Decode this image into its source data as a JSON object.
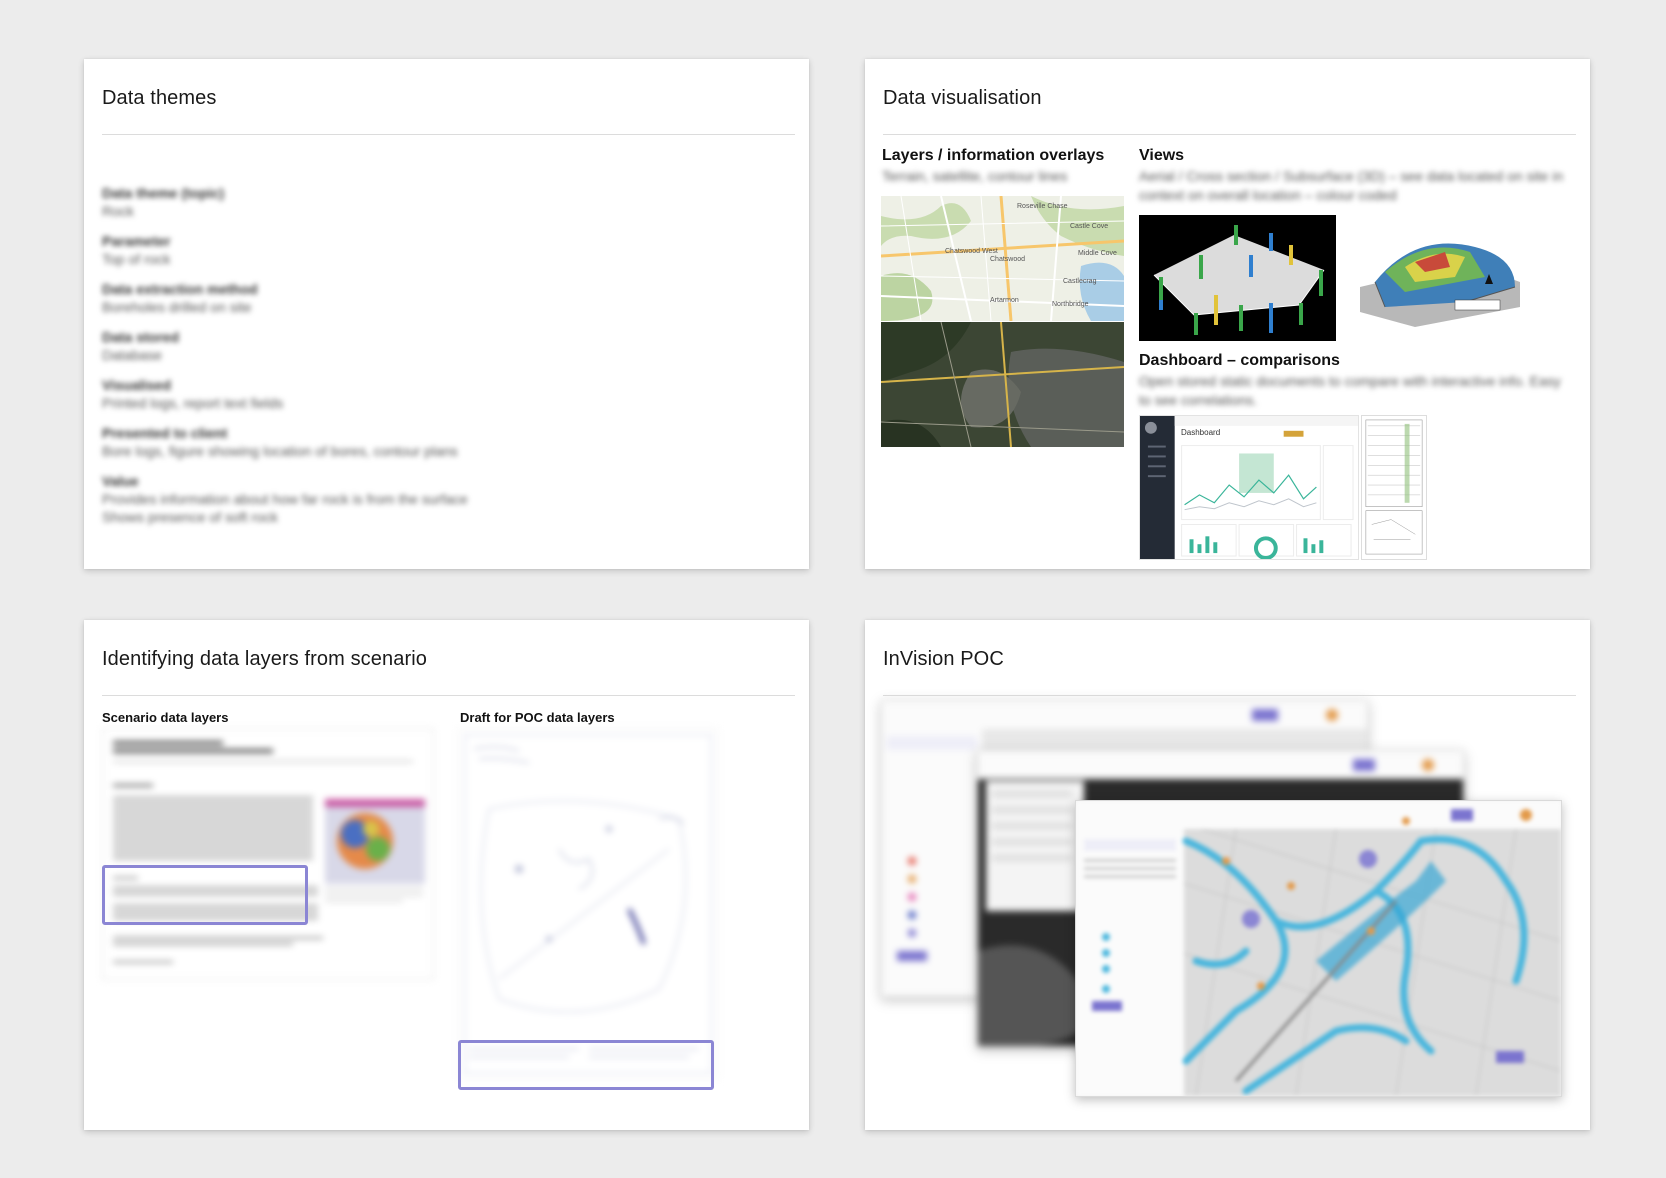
{
  "slides": {
    "themes": {
      "title": "Data themes",
      "items": [
        {
          "label": "Data theme (topic)",
          "value": "Rock"
        },
        {
          "label": "Parameter",
          "value": "Top of rock"
        },
        {
          "label": "Data extraction method",
          "value": "Boreholes drilled on site"
        },
        {
          "label": "Data stored",
          "value": "Database"
        },
        {
          "label": "Visualised",
          "value": "Printed logs, report text fields"
        },
        {
          "label": "Presented to client",
          "value": "Bore logs, figure showing location of bores, contour plans"
        },
        {
          "label": "Value",
          "value": "Provides information about how far rock is from the surface\nShows presence of soft rock"
        }
      ]
    },
    "visualisation": {
      "title": "Data visualisation",
      "layers": {
        "heading": "Layers / information overlays",
        "desc": "Terrain, satellite, contour lines"
      },
      "views": {
        "heading": "Views",
        "desc": "Aerial / Cross section / Subsurface (3D) – see data located on site in context on overall location – colour coded"
      },
      "dashboard": {
        "heading": "Dashboard – comparisons",
        "desc": "Open stored static documents to compare with interactive info. Easy to see correlations."
      },
      "map_labels": [
        "Roseville Chase",
        "Chatswood West",
        "Chatswood",
        "Castle Cove",
        "Middle Cove",
        "Castlecrag",
        "Artarmon",
        "Northbridge"
      ],
      "dashboard_title": "Dashboard"
    },
    "scenario": {
      "title": "Identifying data layers from scenario",
      "col1": "Scenario data layers",
      "col2": "Draft for POC data layers"
    },
    "poc": {
      "title": "InVision POC"
    }
  },
  "colors": {
    "highlight": "#8b86d4",
    "accent_purple": "#7b74cf",
    "map_water": "#49b6dd"
  }
}
